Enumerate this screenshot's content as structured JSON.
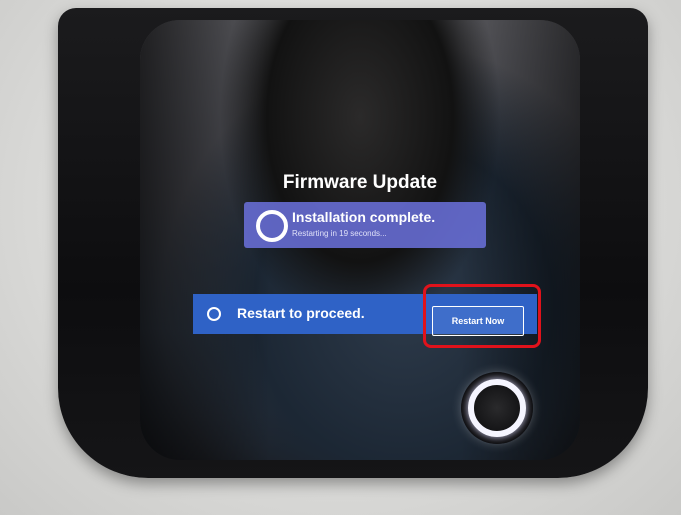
{
  "screen": {
    "title": "Firmware Update",
    "status": {
      "icon": "progress-ring-icon",
      "main_text": "Installation complete.",
      "sub_text": "Restarting in 19 seconds..."
    },
    "restart_bar": {
      "icon": "check-circle-icon",
      "text": "Restart to proceed.",
      "button_label": "Restart Now"
    }
  },
  "colors": {
    "status_card": "#696ED7",
    "restart_bar": "#2F62C6",
    "highlight": "#E0121B"
  }
}
